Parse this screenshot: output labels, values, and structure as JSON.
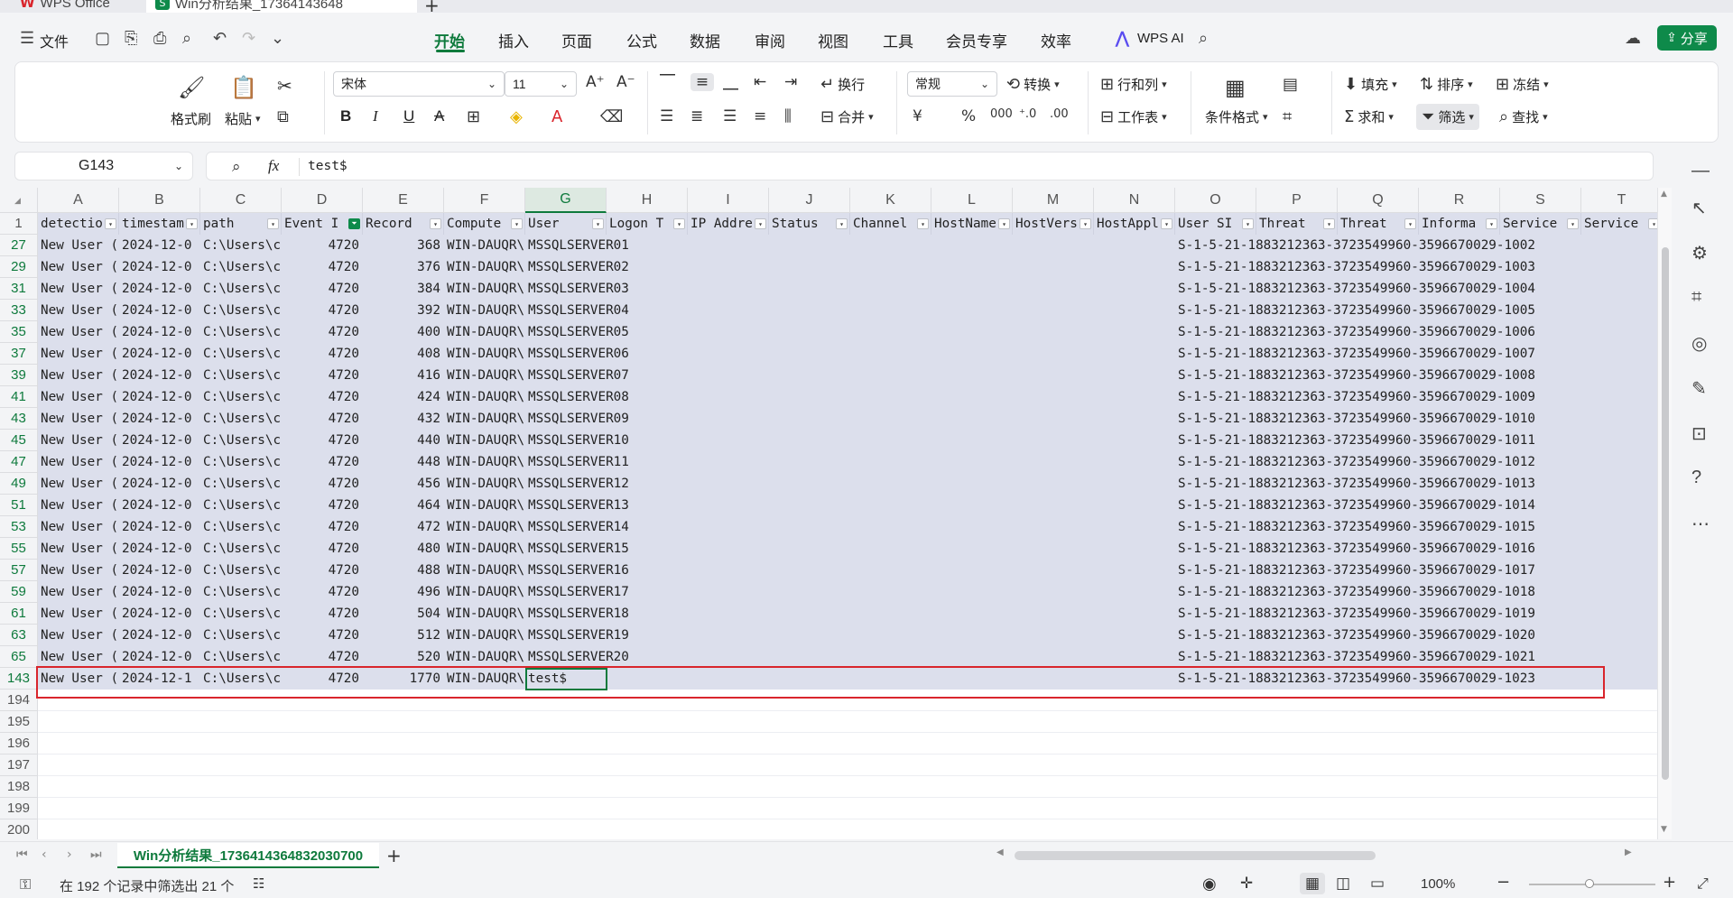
{
  "titlebar": {
    "tabs": [
      "WPS Office",
      "Win分析结果_17364143648"
    ]
  },
  "menubar": {
    "file": "文件",
    "tabs": [
      "开始",
      "插入",
      "页面",
      "公式",
      "数据",
      "审阅",
      "视图",
      "工具",
      "会员专享",
      "效率"
    ],
    "active_tab": "开始",
    "wps_ai": "WPS AI",
    "share": "分享"
  },
  "ribbon": {
    "format_painter": "格式刷",
    "paste": "粘贴",
    "font_name": "宋体",
    "font_size": "11",
    "wrap": "换行",
    "merge": "合并",
    "number_format": "常规",
    "convert": "转换",
    "rows_cols": "行和列",
    "worksheet": "工作表",
    "conditional_format": "条件格式",
    "fill": "填充",
    "sort": "排序",
    "freeze": "冻结",
    "sum": "求和",
    "filter": "筛选",
    "find": "查找",
    "bold": "B",
    "italic": "I",
    "underline": "U",
    "strike": "A"
  },
  "formula": {
    "name_box": "G143",
    "fx": "fx",
    "value": "test$"
  },
  "columns": [
    "A",
    "B",
    "C",
    "D",
    "E",
    "F",
    "G",
    "H",
    "I",
    "J",
    "K",
    "L",
    "M",
    "N",
    "O",
    "P",
    "Q",
    "R",
    "S",
    "T"
  ],
  "selected_column": "G",
  "header_row": {
    "row_num": "1",
    "cells": [
      "detectio",
      "timestam",
      "path",
      "Event I",
      "Record",
      "Compute",
      "User",
      "Logon T",
      "IP Addre",
      "Status",
      "Channel",
      "HostName",
      "HostVers",
      "HostAppl",
      "User SI",
      "Threat",
      "Threat",
      "Informa",
      "Service",
      "Service"
    ]
  },
  "filtered_column": "D",
  "rows": [
    {
      "num": "27",
      "a": "New User (",
      "b": "2024-12-0",
      "c": "C:\\Users\\c",
      "d": "4720",
      "e": "368",
      "f": "WIN-DAUQR\\",
      "g": "MSSQLSERVER01",
      "o": "S-1-5-21-1883212363-3723549960-3596670029-1002"
    },
    {
      "num": "29",
      "a": "New User (",
      "b": "2024-12-0",
      "c": "C:\\Users\\c",
      "d": "4720",
      "e": "376",
      "f": "WIN-DAUQR\\",
      "g": "MSSQLSERVER02",
      "o": "S-1-5-21-1883212363-3723549960-3596670029-1003"
    },
    {
      "num": "31",
      "a": "New User (",
      "b": "2024-12-0",
      "c": "C:\\Users\\c",
      "d": "4720",
      "e": "384",
      "f": "WIN-DAUQR\\",
      "g": "MSSQLSERVER03",
      "o": "S-1-5-21-1883212363-3723549960-3596670029-1004"
    },
    {
      "num": "33",
      "a": "New User (",
      "b": "2024-12-0",
      "c": "C:\\Users\\c",
      "d": "4720",
      "e": "392",
      "f": "WIN-DAUQR\\",
      "g": "MSSQLSERVER04",
      "o": "S-1-5-21-1883212363-3723549960-3596670029-1005"
    },
    {
      "num": "35",
      "a": "New User (",
      "b": "2024-12-0",
      "c": "C:\\Users\\c",
      "d": "4720",
      "e": "400",
      "f": "WIN-DAUQR\\",
      "g": "MSSQLSERVER05",
      "o": "S-1-5-21-1883212363-3723549960-3596670029-1006"
    },
    {
      "num": "37",
      "a": "New User (",
      "b": "2024-12-0",
      "c": "C:\\Users\\c",
      "d": "4720",
      "e": "408",
      "f": "WIN-DAUQR\\",
      "g": "MSSQLSERVER06",
      "o": "S-1-5-21-1883212363-3723549960-3596670029-1007"
    },
    {
      "num": "39",
      "a": "New User (",
      "b": "2024-12-0",
      "c": "C:\\Users\\c",
      "d": "4720",
      "e": "416",
      "f": "WIN-DAUQR\\",
      "g": "MSSQLSERVER07",
      "o": "S-1-5-21-1883212363-3723549960-3596670029-1008"
    },
    {
      "num": "41",
      "a": "New User (",
      "b": "2024-12-0",
      "c": "C:\\Users\\c",
      "d": "4720",
      "e": "424",
      "f": "WIN-DAUQR\\",
      "g": "MSSQLSERVER08",
      "o": "S-1-5-21-1883212363-3723549960-3596670029-1009"
    },
    {
      "num": "43",
      "a": "New User (",
      "b": "2024-12-0",
      "c": "C:\\Users\\c",
      "d": "4720",
      "e": "432",
      "f": "WIN-DAUQR\\",
      "g": "MSSQLSERVER09",
      "o": "S-1-5-21-1883212363-3723549960-3596670029-1010"
    },
    {
      "num": "45",
      "a": "New User (",
      "b": "2024-12-0",
      "c": "C:\\Users\\c",
      "d": "4720",
      "e": "440",
      "f": "WIN-DAUQR\\",
      "g": "MSSQLSERVER10",
      "o": "S-1-5-21-1883212363-3723549960-3596670029-1011"
    },
    {
      "num": "47",
      "a": "New User (",
      "b": "2024-12-0",
      "c": "C:\\Users\\c",
      "d": "4720",
      "e": "448",
      "f": "WIN-DAUQR\\",
      "g": "MSSQLSERVER11",
      "o": "S-1-5-21-1883212363-3723549960-3596670029-1012"
    },
    {
      "num": "49",
      "a": "New User (",
      "b": "2024-12-0",
      "c": "C:\\Users\\c",
      "d": "4720",
      "e": "456",
      "f": "WIN-DAUQR\\",
      "g": "MSSQLSERVER12",
      "o": "S-1-5-21-1883212363-3723549960-3596670029-1013"
    },
    {
      "num": "51",
      "a": "New User (",
      "b": "2024-12-0",
      "c": "C:\\Users\\c",
      "d": "4720",
      "e": "464",
      "f": "WIN-DAUQR\\",
      "g": "MSSQLSERVER13",
      "o": "S-1-5-21-1883212363-3723549960-3596670029-1014"
    },
    {
      "num": "53",
      "a": "New User (",
      "b": "2024-12-0",
      "c": "C:\\Users\\c",
      "d": "4720",
      "e": "472",
      "f": "WIN-DAUQR\\",
      "g": "MSSQLSERVER14",
      "o": "S-1-5-21-1883212363-3723549960-3596670029-1015"
    },
    {
      "num": "55",
      "a": "New User (",
      "b": "2024-12-0",
      "c": "C:\\Users\\c",
      "d": "4720",
      "e": "480",
      "f": "WIN-DAUQR\\",
      "g": "MSSQLSERVER15",
      "o": "S-1-5-21-1883212363-3723549960-3596670029-1016"
    },
    {
      "num": "57",
      "a": "New User (",
      "b": "2024-12-0",
      "c": "C:\\Users\\c",
      "d": "4720",
      "e": "488",
      "f": "WIN-DAUQR\\",
      "g": "MSSQLSERVER16",
      "o": "S-1-5-21-1883212363-3723549960-3596670029-1017"
    },
    {
      "num": "59",
      "a": "New User (",
      "b": "2024-12-0",
      "c": "C:\\Users\\c",
      "d": "4720",
      "e": "496",
      "f": "WIN-DAUQR\\",
      "g": "MSSQLSERVER17",
      "o": "S-1-5-21-1883212363-3723549960-3596670029-1018"
    },
    {
      "num": "61",
      "a": "New User (",
      "b": "2024-12-0",
      "c": "C:\\Users\\c",
      "d": "4720",
      "e": "504",
      "f": "WIN-DAUQR\\",
      "g": "MSSQLSERVER18",
      "o": "S-1-5-21-1883212363-3723549960-3596670029-1019"
    },
    {
      "num": "63",
      "a": "New User (",
      "b": "2024-12-0",
      "c": "C:\\Users\\c",
      "d": "4720",
      "e": "512",
      "f": "WIN-DAUQR\\",
      "g": "MSSQLSERVER19",
      "o": "S-1-5-21-1883212363-3723549960-3596670029-1020"
    },
    {
      "num": "65",
      "a": "New User (",
      "b": "2024-12-0",
      "c": "C:\\Users\\c",
      "d": "4720",
      "e": "520",
      "f": "WIN-DAUQR\\",
      "g": "MSSQLSERVER20",
      "o": "S-1-5-21-1883212363-3723549960-3596670029-1021"
    },
    {
      "num": "143",
      "a": "New User (",
      "b": "2024-12-1",
      "c": "C:\\Users\\c",
      "d": "4720",
      "e": "1770",
      "f": "WIN-DAUQR\\",
      "g": "test$",
      "o": "S-1-5-21-1883212363-3723549960-3596670029-1023"
    }
  ],
  "empty_rows": [
    "194",
    "195",
    "196",
    "197",
    "198",
    "199",
    "200"
  ],
  "sheet_tab": "Win分析结果_1736414364832030700",
  "status": {
    "filter_info": "在 192 个记录中筛选出 21 个",
    "zoom": "100%"
  },
  "colors": {
    "accent": "#0e7a3c",
    "filtered_band": "#dcdfec",
    "highlight_box": "#d9252c"
  }
}
